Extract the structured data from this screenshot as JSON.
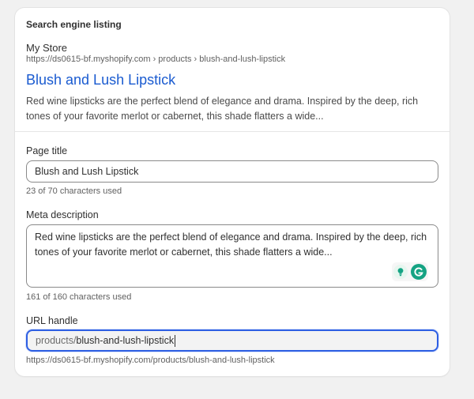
{
  "section": {
    "title": "Search engine listing"
  },
  "preview": {
    "store_name": "My Store",
    "url": "https://ds0615-bf.myshopify.com › products › blush-and-lush-lipstick",
    "title": "Blush and Lush Lipstick",
    "description": "Red wine lipsticks are the perfect blend of elegance and drama. Inspired by the deep, rich tones of your favorite merlot or cabernet, this shade flatters a wide..."
  },
  "page_title": {
    "label": "Page title",
    "value": "Blush and Lush Lipstick",
    "help": "23 of 70 characters used"
  },
  "meta_description": {
    "label": "Meta description",
    "value": "Red wine lipsticks are the perfect blend of elegance and drama. Inspired by the deep, rich tones of your favorite merlot or cabernet, this shade flatters a wide...",
    "help": "161 of 160 characters used",
    "extension_icons": [
      "lightbulb-icon",
      "grammarly-icon"
    ]
  },
  "url_handle": {
    "label": "URL handle",
    "prefix": "products/",
    "value": "blush-and-lush-lipstick",
    "help": "https://ds0615-bf.myshopify.com/products/blush-and-lush-lipstick"
  },
  "colors": {
    "link": "#1a5bd0",
    "focus": "#2e5fe3",
    "grammarly": "#15a383"
  }
}
